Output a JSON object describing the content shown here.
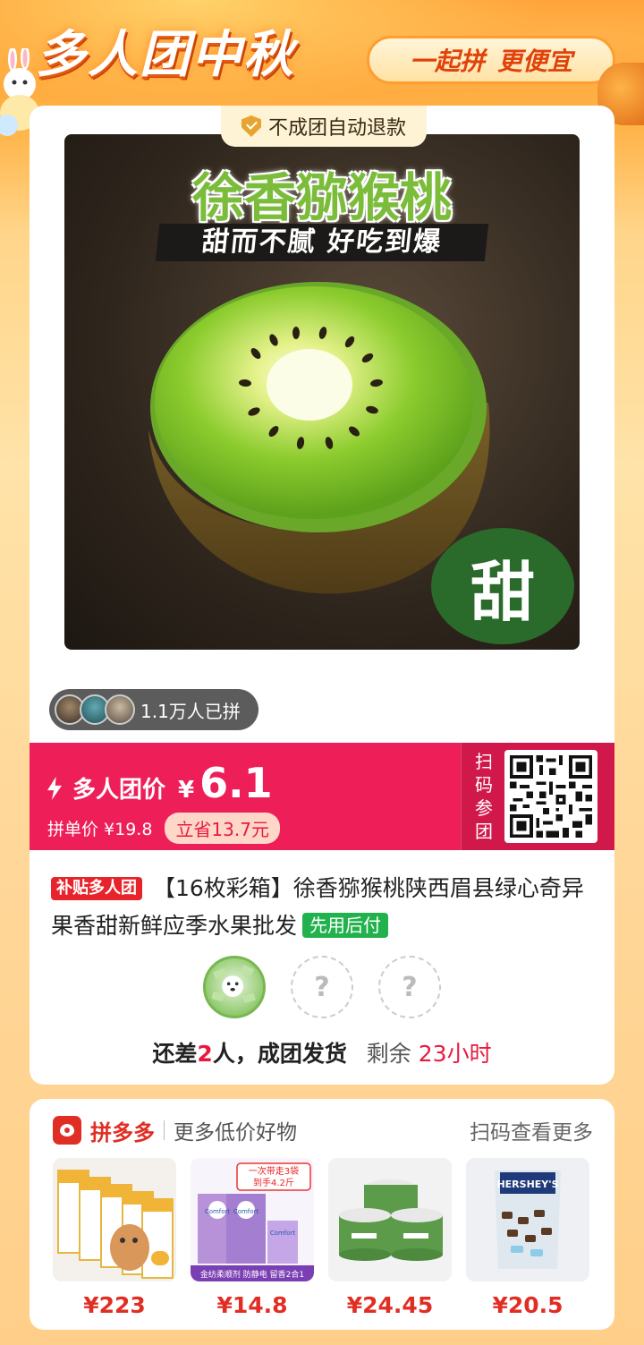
{
  "banner": {
    "title": "多人团中秋",
    "slogan_a": "一起拼",
    "slogan_b": "更便宜"
  },
  "refund_tag": "不成团自动退款",
  "product_image": {
    "headline": "徐香猕猴桃",
    "subline": "甜而不腻 好吃到爆",
    "badge": "甜"
  },
  "joined": {
    "text": "1.1万人已拼"
  },
  "price": {
    "label": "多人团价",
    "currency": "¥",
    "value": "6.1",
    "single_price_label": "拼单价 ¥19.8",
    "save_label": "立省13.7元"
  },
  "scan": {
    "chars": [
      "扫",
      "码",
      "参",
      "团"
    ]
  },
  "product": {
    "subsidy_tag": "补贴多人团",
    "title": "【16枚彩箱】徐香猕猴桃陕西眉县绿心奇异果香甜新鲜应季水果批发",
    "pay_later_tag": "先用后付"
  },
  "group_status": {
    "need_prefix": "还差",
    "need_count": "2",
    "need_suffix": "人，成团发货",
    "remain_label": "剩余",
    "remain_time": "23小时",
    "empty_slot": "?"
  },
  "recommend": {
    "brand": "拼多多",
    "subtitle": "更多低价好物",
    "more": "扫码查看更多",
    "items": [
      {
        "price": "¥223",
        "icon": "cat-food-bags"
      },
      {
        "price": "¥14.8",
        "icon": "fabric-softener",
        "img_top": "一次带走3袋",
        "img_top2": "到手4.2斤",
        "brand": "Comfort",
        "img_bottom": "金纺柔顺剂 防静电 留香2合1"
      },
      {
        "price": "¥24.45",
        "icon": "cotton-pads"
      },
      {
        "price": "¥20.5",
        "icon": "hersheys-candy",
        "brand": "HERSHEY'S"
      }
    ]
  },
  "colors": {
    "accent": "#ee1f58",
    "brand_red": "#e02e24",
    "green": "#21b24d",
    "banner_orange": "#ff9a2e"
  }
}
